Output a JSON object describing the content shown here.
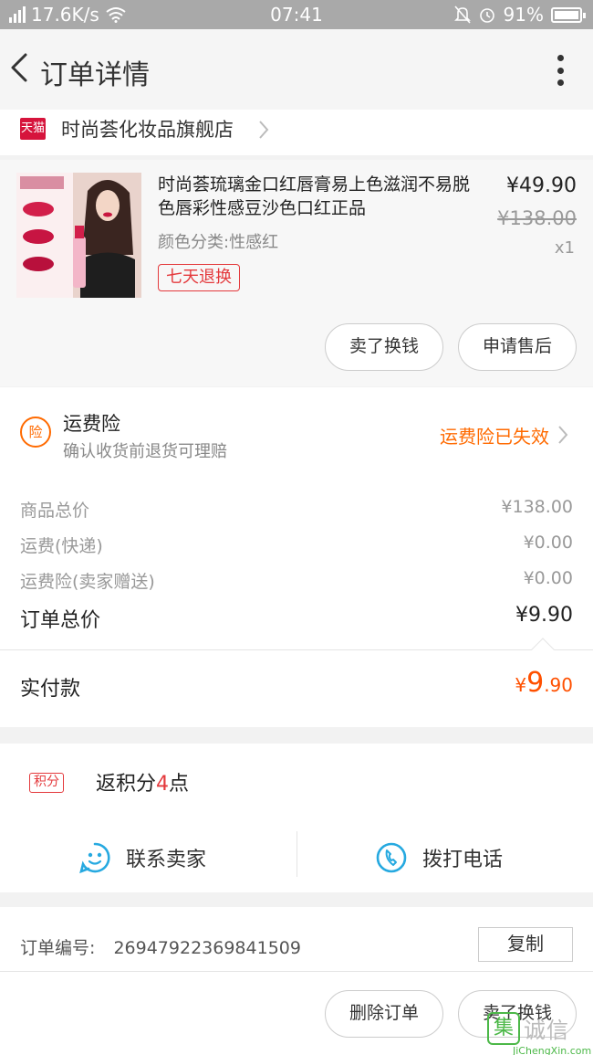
{
  "status_bar": {
    "network_speed": "17.6K/s",
    "time": "07:41",
    "battery": "91%"
  },
  "header": {
    "title": "订单详情"
  },
  "shop": {
    "platform_badge": "天猫",
    "name": "时尚荟化妆品旗舰店"
  },
  "product": {
    "title": "时尚荟琉璃金口红唇膏易上色滋润不易脱色唇彩性感豆沙色口红正品",
    "variant": "颜色分类:性感红",
    "return_tag": "七天退换",
    "price": "¥49.90",
    "original_price": "¥138.00",
    "quantity": "x1",
    "actions": [
      "卖了换钱",
      "申请售后"
    ]
  },
  "insurance": {
    "icon_label": "险",
    "title": "运费险",
    "subtitle": "确认收货前退货可理赔",
    "status": "运费险已失效",
    "status_color": "#ff6a00"
  },
  "fees": [
    {
      "label": "商品总价",
      "value": "¥138.00"
    },
    {
      "label": "运费(快递)",
      "value": "¥0.00"
    },
    {
      "label": "运费险(卖家赠送)",
      "value": "¥0.00"
    }
  ],
  "order_total": {
    "label": "订单总价",
    "value": "¥9.90"
  },
  "paid": {
    "label": "实付款",
    "currency": "¥",
    "integer": "9",
    "decimal": ".90",
    "color": "#ff5000"
  },
  "points": {
    "tag": "积分",
    "prefix": "返积分",
    "count": "4",
    "suffix": "点"
  },
  "contact": {
    "seller_label": "联系卖家",
    "call_label": "拨打电话"
  },
  "order_info": {
    "label": "订单编号:",
    "number": "2694792236984150​9",
    "copy_label": "复制"
  },
  "bottom_actions": [
    "删除订单",
    "卖了换钱"
  ],
  "watermark": {
    "box": "集",
    "text": "诚信",
    "url_text": "JiChengXin.com"
  }
}
